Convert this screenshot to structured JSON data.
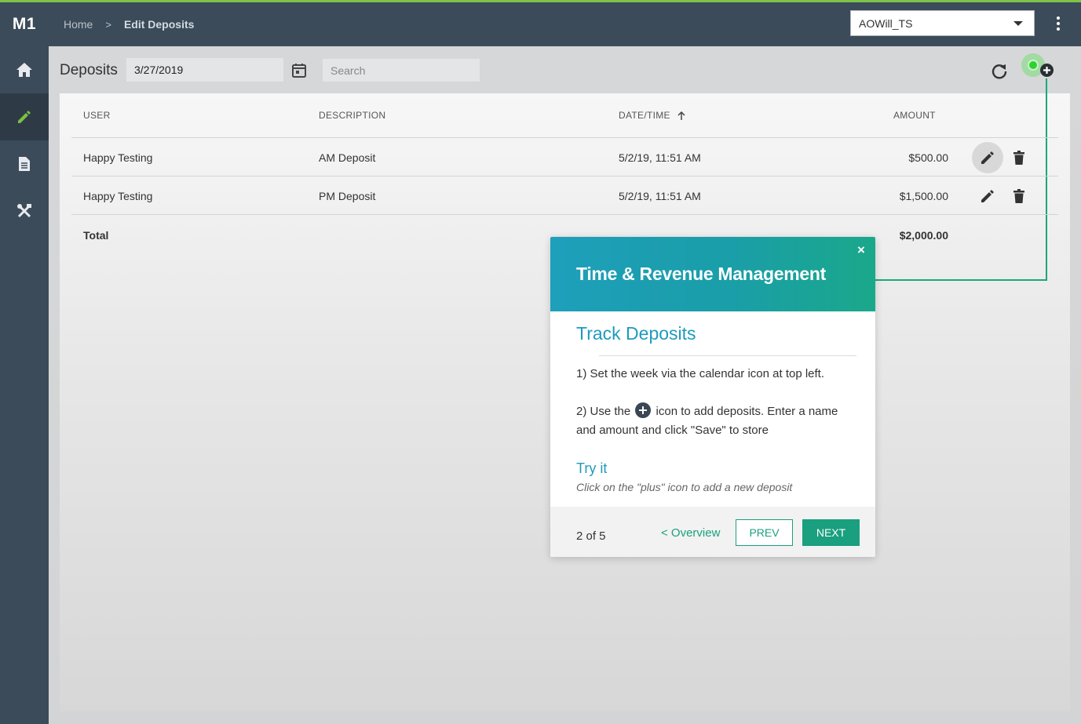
{
  "app": {
    "logo": "M1"
  },
  "breadcrumb": {
    "home": "Home",
    "separator": ">",
    "current": "Edit Deposits"
  },
  "account": {
    "selected": "AOWill_TS"
  },
  "sidebar": {
    "items": [
      {
        "name": "home",
        "icon": "home-icon"
      },
      {
        "name": "edit",
        "icon": "pencil-icon",
        "active": true
      },
      {
        "name": "documents",
        "icon": "document-icon"
      },
      {
        "name": "tools",
        "icon": "tools-icon"
      }
    ]
  },
  "toolbar": {
    "title": "Deposits",
    "date_value": "3/27/2019",
    "search_placeholder": "Search"
  },
  "table": {
    "headers": {
      "user": "USER",
      "description": "DESCRIPTION",
      "datetime": "DATE/TIME",
      "amount": "AMOUNT"
    },
    "rows": [
      {
        "user": "Happy Testing",
        "description": "AM Deposit",
        "datetime": "5/2/19, 11:51 AM",
        "amount": "$500.00"
      },
      {
        "user": "Happy Testing",
        "description": "PM Deposit",
        "datetime": "5/2/19, 11:51 AM",
        "amount": "$1,500.00"
      }
    ],
    "total": {
      "label": "Total",
      "amount": "$2,000.00"
    }
  },
  "tour": {
    "title": "Time & Revenue Management",
    "close": "×",
    "subtitle": "Track Deposits",
    "step1": "1) Set the week via the calendar icon at top left.",
    "step2_before": "2) Use the",
    "step2_after": "icon to add deposits. Enter a name and amount and click \"Save\" to store",
    "try_title": "Try it",
    "try_hint": "Click on the \"plus\" icon to add a new deposit",
    "progress": "2 of 5",
    "overview_link": "< Overview",
    "prev_label": "PREV",
    "next_label": "NEXT"
  },
  "colors": {
    "accent": "#1a9f7f",
    "header": "#3c4b59",
    "highlight": "#2fd12f"
  }
}
